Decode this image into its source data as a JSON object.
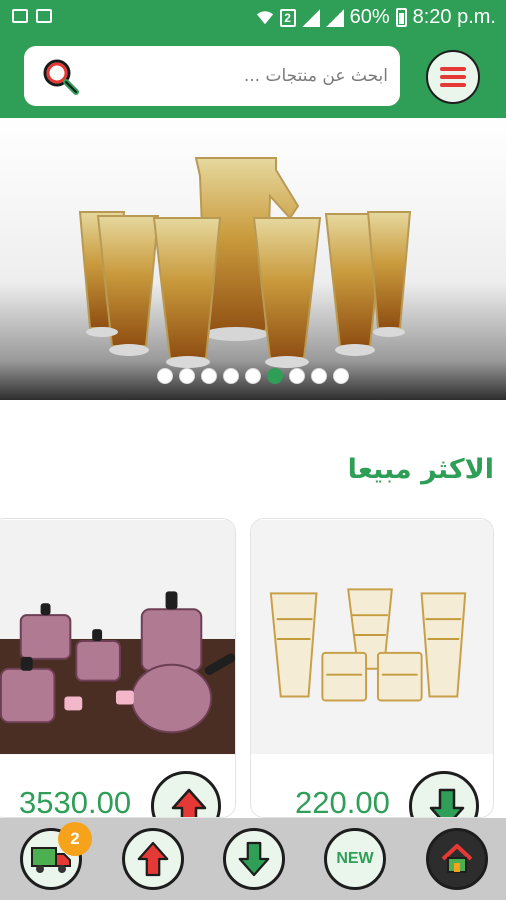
{
  "status_bar": {
    "battery": "60%",
    "time": "8:20 p.m.",
    "sim_slot": "2"
  },
  "header": {
    "search_placeholder": "ابحث عن منتجات ...",
    "search_icon": "magnifier-icon",
    "menu_icon": "hamburger-icon"
  },
  "banner": {
    "slide_count": 9,
    "active_slide": 6
  },
  "section": {
    "title": "الاكثر مبيعا"
  },
  "products": [
    {
      "price": "220.00",
      "action_icon": "arrow-down-icon"
    },
    {
      "price": "3530.00",
      "action_icon": "arrow-up-icon"
    }
  ],
  "bottom_nav": {
    "cart_badge": "2",
    "new_label": "NEW",
    "items": [
      "delivery-truck-icon",
      "arrow-up-icon",
      "arrow-down-icon",
      "new-icon",
      "home-icon"
    ]
  },
  "colors": {
    "brand_green": "#2f9e57",
    "accent_red": "#e53935",
    "badge_orange": "#f7a21b",
    "nav_background": "#c9c9c9"
  }
}
